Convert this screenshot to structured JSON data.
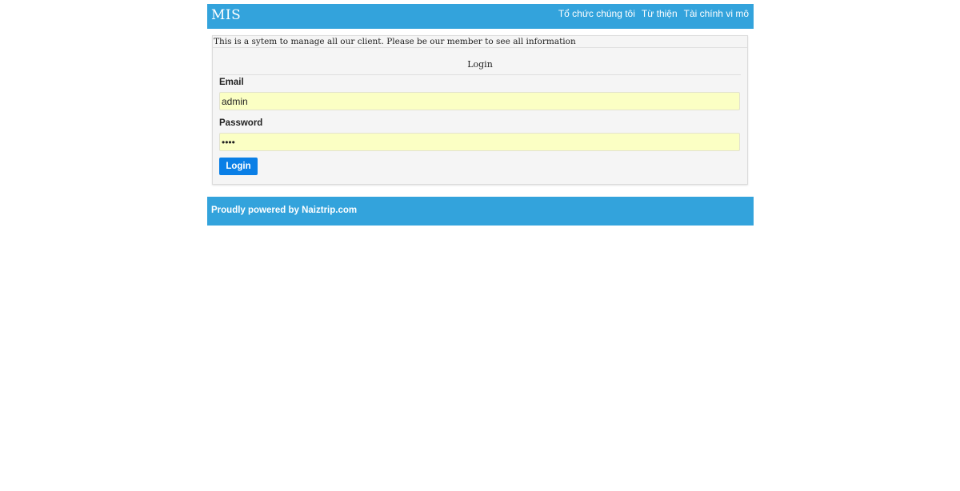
{
  "header": {
    "brand": "MIS",
    "nav": [
      {
        "label": "Tổ chức chúng tôi"
      },
      {
        "label": "Từ thiện"
      },
      {
        "label": "Tài chính vi mô"
      }
    ]
  },
  "panel": {
    "intro": "This is a sytem to manage all our client. Please be our member to see all information",
    "title": "Login",
    "email_label": "Email",
    "email_value": "admin",
    "password_label": "Password",
    "password_value": "••••",
    "login_button": "Login"
  },
  "footer": {
    "text": "Proudly powered by Naiztrip.com"
  },
  "colors": {
    "brand_blue": "#33a3dc",
    "button_blue": "#0a7fe6",
    "autofill_yellow": "#fbffc4",
    "panel_bg": "#f5f5f5"
  }
}
